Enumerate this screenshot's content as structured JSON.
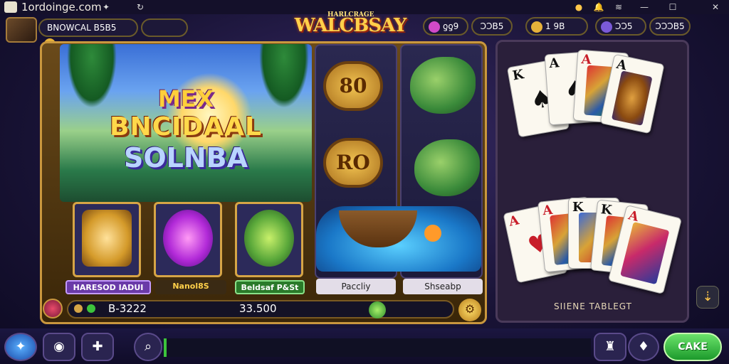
{
  "browser": {
    "site": "1ordoinge.com",
    "window_controls": {
      "minimize": "—",
      "maximize": "☐",
      "close": "✕"
    }
  },
  "header": {
    "player_name": "BNOWCAL B5B5",
    "logo_small": "HARLCRAGE",
    "logo": "WALCBSAY",
    "stats": [
      {
        "left": "ƍƍ9",
        "right": "ƆƆB5"
      },
      {
        "value": "1 9B"
      },
      {
        "left": "ƆƆ5",
        "right": "ƆƆƆB5"
      }
    ]
  },
  "main": {
    "title_lines": [
      "MEX",
      "BNCIDAAL",
      "SOLNBA"
    ],
    "tiles": [
      {
        "label": "HARESOD IADUI"
      },
      {
        "label": "Nanol8S"
      },
      {
        "label": "Beldsaf P&St"
      }
    ],
    "column_left": {
      "badge_top": "80",
      "badge_bottom": "RO",
      "label": "Paccliy"
    },
    "column_right": {
      "label": "Shseabp"
    },
    "bottom": {
      "id": "B-3222",
      "amount": "33.500"
    }
  },
  "cards": {
    "top_hand": [
      {
        "rank": "K",
        "suit": "♠"
      },
      {
        "rank": "A",
        "suit": "♠"
      },
      {
        "rank": "A",
        "suit": "♥"
      },
      {
        "rank": "A",
        "suit": "♣"
      }
    ],
    "bottom_hand": [
      {
        "rank": "A",
        "suit": "♥"
      },
      {
        "rank": "A",
        "suit": "♥"
      },
      {
        "rank": "K",
        "suit": "♠"
      },
      {
        "rank": "K",
        "suit": "♠"
      },
      {
        "rank": "A",
        "suit": "♥"
      }
    ],
    "panel_label": "SIIENE TABLEGT"
  },
  "footer": {
    "cta": "CAKE"
  },
  "colors": {
    "gold": "#c9973e",
    "accent_green": "#3cc43c",
    "panel_dark": "#2a1f3a"
  }
}
